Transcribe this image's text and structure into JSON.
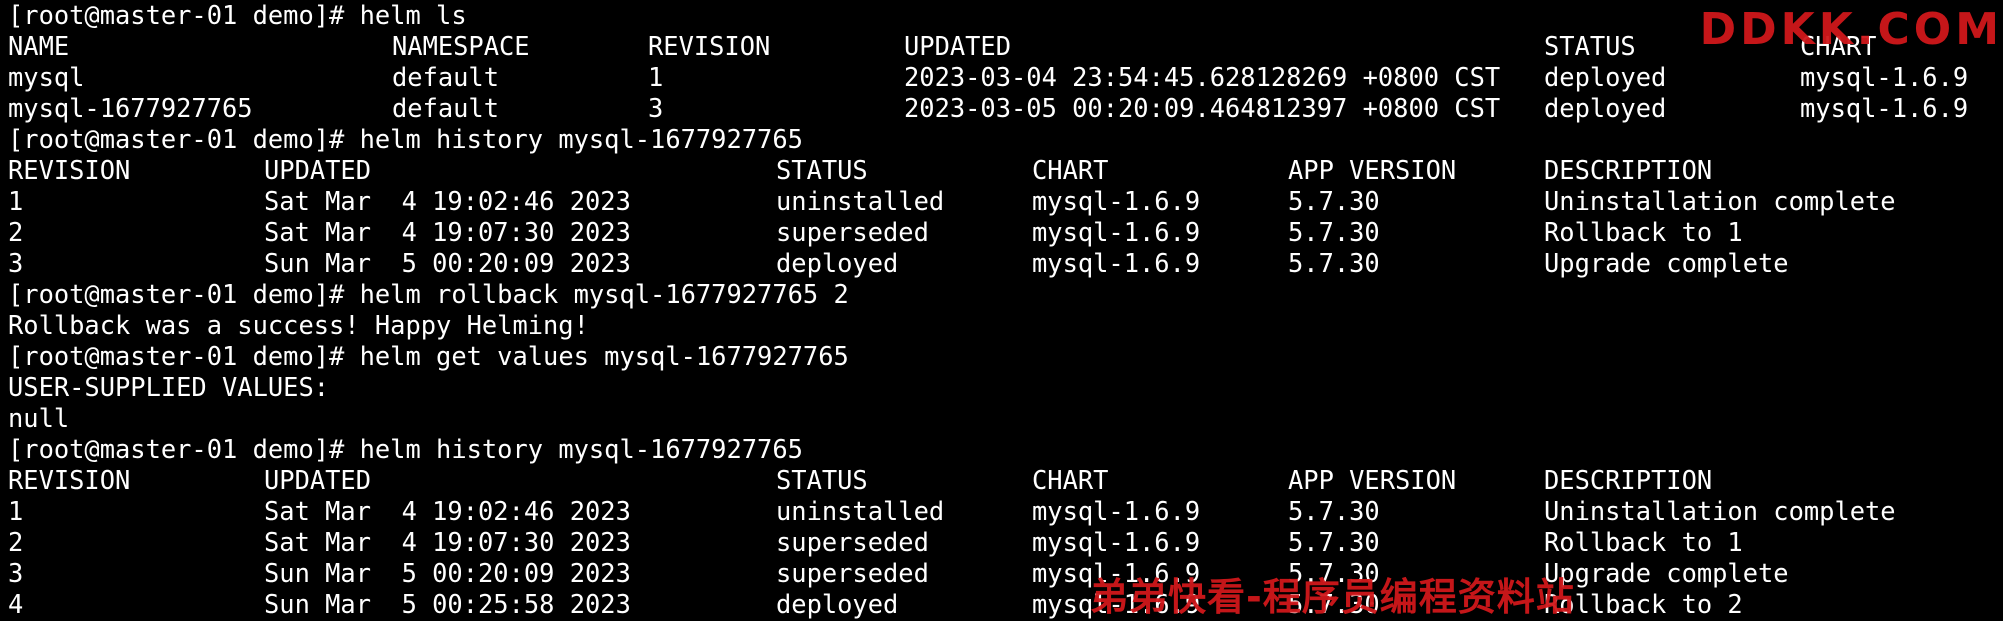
{
  "colors": {
    "background": "#000000",
    "text": "#ffffff",
    "watermark": "#d0181b"
  },
  "terminal": {
    "lines": [
      {
        "kind": "prompt",
        "prompt": "[root@master-01 demo]#",
        "command": " helm ls"
      },
      {
        "kind": "row",
        "cells": [
          "NAME",
          "NAMESPACE",
          "REVISION",
          "UPDATED",
          "STATUS",
          "CHART"
        ],
        "cols": [
          "c0",
          "c39",
          "c52",
          "c65a",
          "c78a",
          "c91a"
        ]
      },
      {
        "kind": "row",
        "cells": [
          "mysql",
          "default",
          "1",
          "2023-03-04 23:54:45.628128269 +0800 CST",
          "deployed",
          "mysql-1.6.9"
        ],
        "cols": [
          "c0",
          "c39",
          "c52",
          "c65a",
          "c78a",
          "c91a"
        ]
      },
      {
        "kind": "row",
        "cells": [
          "mysql-1677927765",
          "default",
          "3",
          "2023-03-05 00:20:09.464812397 +0800 CST",
          "deployed",
          "mysql-1.6.9"
        ],
        "cols": [
          "c0",
          "c39",
          "c52",
          "c65a",
          "c78a",
          "c91a"
        ]
      },
      {
        "kind": "prompt",
        "prompt": "[root@master-01 demo]#",
        "command": " helm history mysql-1677927765"
      },
      {
        "kind": "row",
        "cells": [
          "REVISION",
          "UPDATED",
          "STATUS",
          "CHART",
          "APP VERSION",
          "DESCRIPTION"
        ],
        "cols": [
          "h0",
          "h1",
          "h2",
          "h3",
          "h4",
          "h5"
        ]
      },
      {
        "kind": "row",
        "cells": [
          "1",
          "Sat Mar  4 19:02:46 2023",
          "uninstalled",
          "mysql-1.6.9",
          "5.7.30",
          "Uninstallation complete"
        ],
        "cols": [
          "h0",
          "h1",
          "h2",
          "h3",
          "h4",
          "h5"
        ]
      },
      {
        "kind": "row",
        "cells": [
          "2",
          "Sat Mar  4 19:07:30 2023",
          "superseded",
          "mysql-1.6.9",
          "5.7.30",
          "Rollback to 1"
        ],
        "cols": [
          "h0",
          "h1",
          "h2",
          "h3",
          "h4",
          "h5"
        ]
      },
      {
        "kind": "row",
        "cells": [
          "3",
          "Sun Mar  5 00:20:09 2023",
          "deployed",
          "mysql-1.6.9",
          "5.7.30",
          "Upgrade complete"
        ],
        "cols": [
          "h0",
          "h1",
          "h2",
          "h3",
          "h4",
          "h5"
        ]
      },
      {
        "kind": "prompt",
        "prompt": "[root@master-01 demo]#",
        "command": " helm rollback mysql-1677927765 2"
      },
      {
        "kind": "text",
        "text": "Rollback was a success! Happy Helming!"
      },
      {
        "kind": "prompt",
        "prompt": "[root@master-01 demo]#",
        "command": " helm get values mysql-1677927765"
      },
      {
        "kind": "text",
        "text": "USER-SUPPLIED VALUES:"
      },
      {
        "kind": "text",
        "text": "null"
      },
      {
        "kind": "prompt",
        "prompt": "[root@master-01 demo]#",
        "command": " helm history mysql-1677927765"
      },
      {
        "kind": "row",
        "cells": [
          "REVISION",
          "UPDATED",
          "STATUS",
          "CHART",
          "APP VERSION",
          "DESCRIPTION"
        ],
        "cols": [
          "h0",
          "h1",
          "h2",
          "h3",
          "h4",
          "h5"
        ]
      },
      {
        "kind": "row",
        "cells": [
          "1",
          "Sat Mar  4 19:02:46 2023",
          "uninstalled",
          "mysql-1.6.9",
          "5.7.30",
          "Uninstallation complete"
        ],
        "cols": [
          "h0",
          "h1",
          "h2",
          "h3",
          "h4",
          "h5"
        ]
      },
      {
        "kind": "row",
        "cells": [
          "2",
          "Sat Mar  4 19:07:30 2023",
          "superseded",
          "mysql-1.6.9",
          "5.7.30",
          "Rollback to 1"
        ],
        "cols": [
          "h0",
          "h1",
          "h2",
          "h3",
          "h4",
          "h5"
        ]
      },
      {
        "kind": "row",
        "cells": [
          "3",
          "Sun Mar  5 00:20:09 2023",
          "superseded",
          "mysql-1.6.9",
          "5.7.30",
          "Upgrade complete"
        ],
        "cols": [
          "h0",
          "h1",
          "h2",
          "h3",
          "h4",
          "h5"
        ]
      },
      {
        "kind": "row",
        "cells": [
          "4",
          "Sun Mar  5 00:25:58 2023",
          "deployed",
          "mysql-1.6.9",
          "5.7.30",
          "Rollback to 2"
        ],
        "cols": [
          "h0",
          "h1",
          "h2",
          "h3",
          "h4",
          "h5"
        ]
      }
    ]
  },
  "watermarks": {
    "top": "DDKK.COM",
    "bottom": "弟弟快看-程序员编程资料站"
  }
}
